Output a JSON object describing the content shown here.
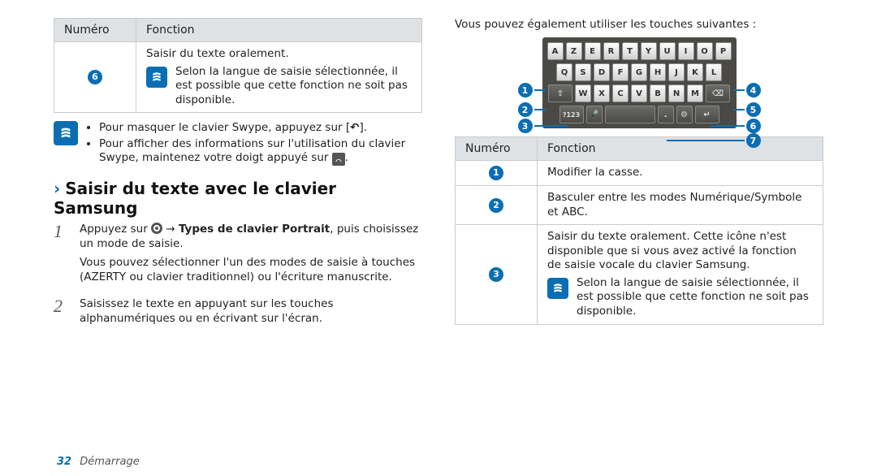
{
  "colors": {
    "accent": "#0b6eb3"
  },
  "left": {
    "table6": {
      "header_num": "Numéro",
      "header_func": "Fonction",
      "row6_num": "6",
      "row6_text_top": "Saisir du texte oralement.",
      "row6_note": "Selon la langue de saisie sélectionnée, il est possible que cette fonction ne soit pas disponible."
    },
    "tip": {
      "bullet1_a": "Pour masquer le clavier Swype, appuyez sur [",
      "bullet1_back_icon": "↶",
      "bullet1_b": "].",
      "bullet2_a": "Pour afficher des informations sur l'utilisation du clavier Swype, maintenez votre doigt appuyé sur ",
      "bullet2_b": "."
    },
    "section_title": "Saisir du texte avec le clavier Samsung",
    "step1_a": "Appuyez sur ",
    "step1_b": " → ",
    "step1_bold": "Types de clavier Portrait",
    "step1_c": ", puis choisissez un mode de saisie.",
    "step1_p2": "Vous pouvez sélectionner l'un des modes de saisie à touches (AZERTY ou clavier traditionnel) ou l'écriture manuscrite.",
    "step2": "Saisissez le texte en appuyant sur les touches alphanumériques ou en écrivant sur l'écran."
  },
  "right": {
    "intro": "Vous pouvez également utiliser les touches suivantes :",
    "kbd_rows": {
      "r1": [
        "A",
        "Z",
        "E",
        "R",
        "T",
        "Y",
        "U",
        "I",
        "O",
        "P"
      ],
      "r2": [
        "Q",
        "S",
        "D",
        "F",
        "G",
        "H",
        "J",
        "K",
        "L"
      ],
      "r3_shift": "⇧",
      "r3": [
        "W",
        "X",
        "C",
        "V",
        "B",
        "N",
        "M"
      ],
      "r3_back": "⌫",
      "r4_mode": "?123",
      "r4_mic": "🎤",
      "r4_gear": "⚙",
      "r4_enter": "↵"
    },
    "callouts": {
      "1": "1",
      "2": "2",
      "3": "3",
      "4": "4",
      "5": "5",
      "6": "6",
      "7": "7"
    },
    "table": {
      "header_num": "Numéro",
      "header_func": "Fonction",
      "r1_num": "1",
      "r1_text": "Modifier la casse.",
      "r2_num": "2",
      "r2_text": "Basculer entre les modes Numérique/Symbole et ABC.",
      "r3_num": "3",
      "r3_text_top": "Saisir du texte oralement. Cette icône n'est disponible que si vous avez activé la fonction de saisie vocale du clavier Samsung.",
      "r3_note": "Selon la langue de saisie sélectionnée, il est possible que cette fonction ne soit pas disponible."
    }
  },
  "footer": {
    "page_num": "32",
    "section": "Démarrage"
  }
}
